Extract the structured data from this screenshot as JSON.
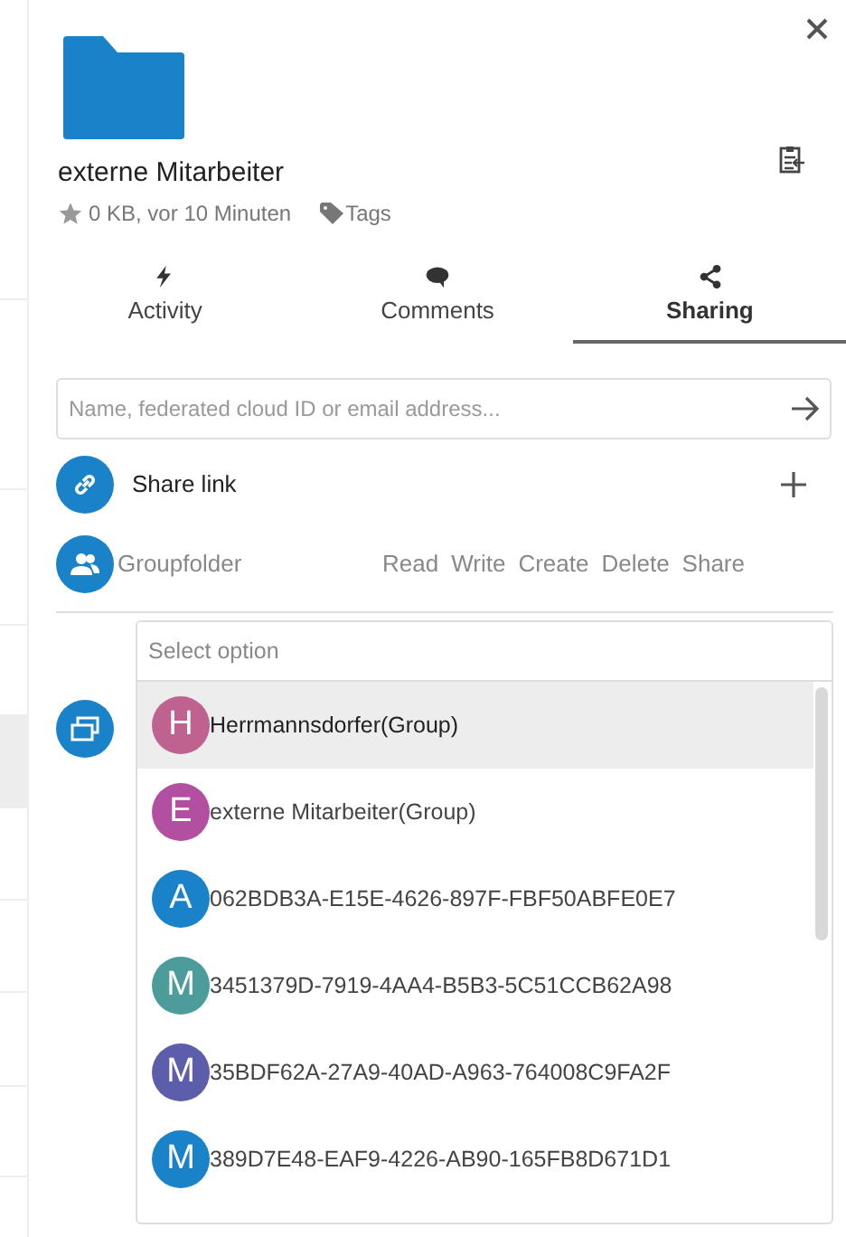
{
  "file": {
    "name": "externe Mitarbeiter",
    "starred": false,
    "meta": "0 KB, vor 10 Minuten",
    "tags_label": "Tags"
  },
  "tabs": [
    {
      "kind": "activity",
      "label": "Activity",
      "selected": false
    },
    {
      "kind": "comments",
      "label": "Comments",
      "selected": false
    },
    {
      "kind": "sharing",
      "label": "Sharing",
      "selected": true
    }
  ],
  "share_input": {
    "placeholder": "Name, federated cloud ID or email address..."
  },
  "share_link": {
    "label": "Share link"
  },
  "groupfolder": {
    "label": "Groupfolder",
    "permissions": [
      "Read",
      "Write",
      "Create",
      "Delete",
      "Share"
    ]
  },
  "dropdown": {
    "placeholder": "Select option",
    "options": [
      {
        "initial": "H",
        "label": "Herrmannsdorfer(Group)",
        "color": "#c0628f",
        "selected": true
      },
      {
        "initial": "E",
        "label": "externe Mitarbeiter(Group)",
        "color": "#b34fa0",
        "selected": false
      },
      {
        "initial": "A",
        "label": "062BDB3A-E15E-4626-897F-FBF50ABFE0E7",
        "color": "#1a82c8",
        "selected": false
      },
      {
        "initial": "M",
        "label": "3451379D-7919-4AA4-B5B3-5C51CCB62A98",
        "color": "#4c9c9c",
        "selected": false
      },
      {
        "initial": "M",
        "label": "35BDF62A-27A9-40AD-A963-764008C9FA2F",
        "color": "#5c5eab",
        "selected": false
      },
      {
        "initial": "M",
        "label": "389D7E48-EAF9-4226-AB90-165FB8D671D1",
        "color": "#1a82c8",
        "selected": false
      }
    ]
  }
}
